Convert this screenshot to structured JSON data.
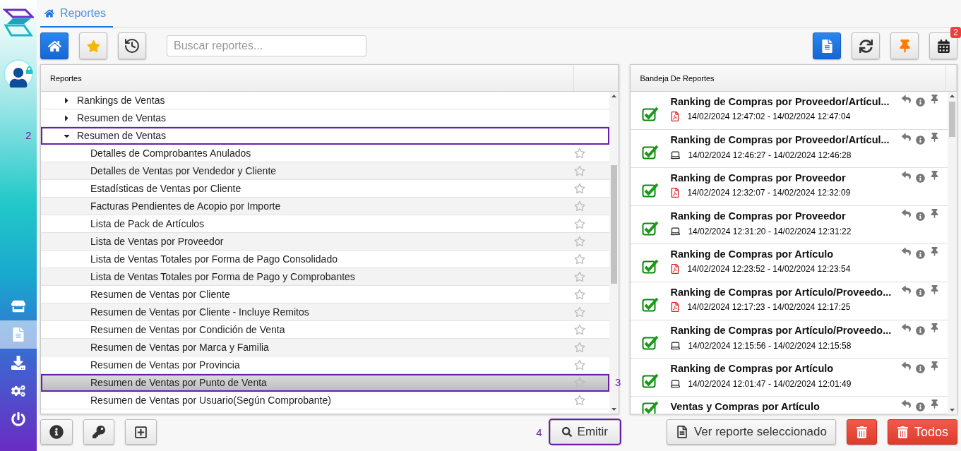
{
  "sidebar": {
    "items": [
      {
        "selected": false
      },
      {
        "selected": true
      },
      {
        "selected": false
      },
      {
        "selected": false
      },
      {
        "selected": false
      }
    ]
  },
  "tabs": [
    {
      "label": "Reportes",
      "selected": true
    }
  ],
  "toolbar": {
    "left_buttons": [
      {
        "selected": true
      },
      {
        "selected": false
      },
      {
        "selected": false
      }
    ],
    "search": {
      "placeholder": "Buscar reportes..."
    },
    "right_buttons": [
      {
        "selected": true
      },
      {
        "selected": false
      },
      {
        "selected": false
      },
      {
        "selected": false,
        "badge": "2"
      }
    ]
  },
  "tree": {
    "header": "Reportes",
    "groups": [
      {
        "label": "Rankings de Ventas",
        "expanded": false
      },
      {
        "label": "Resumen de Ventas",
        "expanded": false
      },
      {
        "label": "Resumen de Ventas",
        "expanded": true,
        "callout": "2",
        "children": [
          {
            "label": "Detalles de Comprobantes Anulados",
            "selected": false,
            "favorite": false
          },
          {
            "label": "Detalles de Ventas por Vendedor y Cliente",
            "selected": false,
            "favorite": false
          },
          {
            "label": "Estadísticas de Ventas por Cliente",
            "selected": false,
            "favorite": false
          },
          {
            "label": "Facturas Pendientes de Acopio por Importe",
            "selected": false,
            "favorite": false
          },
          {
            "label": "Lista de Pack de Artículos",
            "selected": false,
            "favorite": false
          },
          {
            "label": "Lista de Ventas por Proveedor",
            "selected": false,
            "favorite": false
          },
          {
            "label": "Lista de Ventas Totales por Forma de Pago Consolidado",
            "selected": false,
            "favorite": false
          },
          {
            "label": "Lista de Ventas Totales por Forma de Pago y Comprobantes",
            "selected": false,
            "favorite": false
          },
          {
            "label": "Resumen de Ventas por Cliente",
            "selected": false,
            "favorite": false
          },
          {
            "label": "Resumen de Ventas por Cliente - Incluye Remitos",
            "selected": false,
            "favorite": false
          },
          {
            "label": "Resumen de Ventas por Condición de Venta",
            "selected": false,
            "favorite": false
          },
          {
            "label": "Resumen de Ventas por Marca y Familia",
            "selected": false,
            "favorite": false
          },
          {
            "label": "Resumen de Ventas por Provincia",
            "selected": false,
            "favorite": false
          },
          {
            "label": "Resumen de Ventas por Punto de Venta",
            "selected": true,
            "favorite": false,
            "callout": "3"
          },
          {
            "label": "Resumen de Ventas por Usuario(Según Comprobante)",
            "selected": false,
            "favorite": false
          }
        ]
      }
    ]
  },
  "tray": {
    "header": "Bandeja De Reportes",
    "items": [
      {
        "title": "Ranking de Compras por Proveedor/Artícul...",
        "kind": "pdf",
        "time": "14/02/2024 12:47:02 - 14/02/2024 12:47:04",
        "done": true
      },
      {
        "title": "Ranking de Compras por Proveedor/Artícul...",
        "kind": "screen",
        "time": "14/02/2024 12:46:27 - 14/02/2024 12:46:28",
        "done": true
      },
      {
        "title": "Ranking de Compras por Proveedor",
        "kind": "pdf",
        "time": "14/02/2024 12:32:07 - 14/02/2024 12:32:09",
        "done": true
      },
      {
        "title": "Ranking de Compras por Proveedor",
        "kind": "screen",
        "time": "14/02/2024 12:31:20 - 14/02/2024 12:31:22",
        "done": true
      },
      {
        "title": "Ranking de Compras por Artículo",
        "kind": "pdf",
        "time": "14/02/2024 12:23:52 - 14/02/2024 12:23:54",
        "done": true
      },
      {
        "title": "Ranking de Compras por Artículo/Proveedo...",
        "kind": "pdf",
        "time": "14/02/2024 12:17:23 - 14/02/2024 12:17:25",
        "done": true
      },
      {
        "title": "Ranking de Compras por Artículo/Proveedo...",
        "kind": "screen",
        "time": "14/02/2024 12:15:56 - 14/02/2024 12:15:58",
        "done": true
      },
      {
        "title": "Ranking de Compras por Artículo",
        "kind": "screen",
        "time": "14/02/2024 12:01:47 - 14/02/2024 12:01:49",
        "done": true
      },
      {
        "title": "Ventas y Compras por Artículo",
        "done": true
      }
    ]
  },
  "bottom": {
    "emit": {
      "label": "Emitir",
      "callout": "4"
    },
    "view": {
      "label": "Ver reporte seleccionado"
    },
    "delete_all": {
      "label": "Todos"
    }
  }
}
